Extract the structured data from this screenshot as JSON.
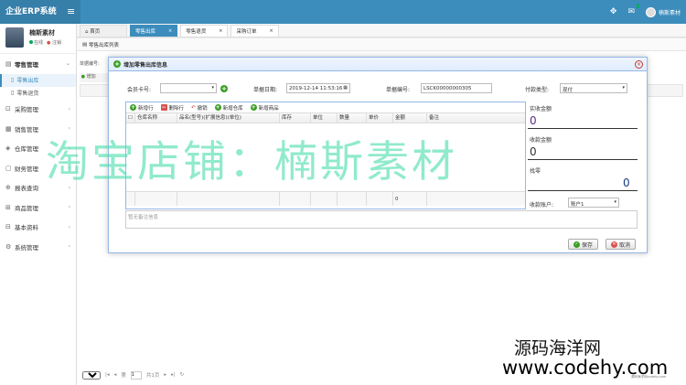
{
  "app": {
    "brand": "企业ERP系统"
  },
  "user": {
    "name": "楠斯素材",
    "online": "在线",
    "logout": "注销"
  },
  "sidebar": {
    "items": [
      {
        "label": "零售管理",
        "open": true,
        "subs": [
          {
            "label": "零售出库",
            "active": true
          },
          {
            "label": "零售退货"
          }
        ]
      },
      {
        "label": "采购管理"
      },
      {
        "label": "销售管理"
      },
      {
        "label": "仓库管理"
      },
      {
        "label": "财务管理"
      },
      {
        "label": "报表查询"
      },
      {
        "label": "商品管理"
      },
      {
        "label": "基本资料"
      },
      {
        "label": "系统管理"
      }
    ]
  },
  "tabs": [
    {
      "label": "首页"
    },
    {
      "label": "零售出库"
    },
    {
      "label": "零售退货"
    },
    {
      "label": "采购订单"
    }
  ],
  "content": {
    "title": "零售出库列表",
    "search_label": "单据编号:",
    "add_label": "增加",
    "pager": {
      "page_size": "15",
      "page_prefix": "第",
      "page": "1",
      "total": "共1页"
    }
  },
  "dialog": {
    "title": "增加零售出库信息",
    "member_label": "会员卡号:",
    "date_label": "单据日期:",
    "date_value": "2019-12-14 11:53:16",
    "number_label": "单据编号:",
    "number_value": "LSCK00000000305",
    "pay_type_label": "付款类型:",
    "pay_type_value": "现付",
    "grid": {
      "toolbar": [
        "新增行",
        "删除行",
        "撤销",
        "新增仓库",
        "新增商品"
      ],
      "columns": [
        "仓库名称",
        "品名(型号)(扩展信息)(单位)",
        "库存",
        "单位",
        "数量",
        "单价",
        "金额",
        "备注"
      ],
      "footer_total": "0"
    },
    "right": {
      "receivable_label": "实收金额",
      "receivable_value": "0",
      "received_label": "收款金额",
      "received_value": "0",
      "change_label": "找零",
      "change_value": "0",
      "account_label": "收款账户:",
      "account_value": "账户1"
    },
    "remark_placeholder": "暂无备注信息",
    "save_label": "保存",
    "cancel_label": "取消"
  },
  "watermark": {
    "main": "淘宝店铺：楠斯素材",
    "line1": "源码海洋网",
    "line2": "www.codehy.com",
    "tiny": "源码海洋网codehy.com"
  }
}
